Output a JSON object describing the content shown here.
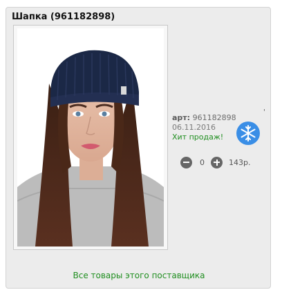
{
  "product": {
    "title": "Шапка (961182898)",
    "article_label": "арт:",
    "article_value": "961182898",
    "date": "06.11.2016",
    "badge_text": "Хит продаж!",
    "season_icon": "snowflake-icon",
    "tick_mark": "'"
  },
  "quantity": {
    "decrease_icon": "minus-icon",
    "value": "0",
    "increase_icon": "plus-icon"
  },
  "price": "143р.",
  "footer": {
    "supplier_link": "Все товары этого поставщика"
  },
  "colors": {
    "link_green": "#1f8e1f",
    "badge_blue": "#3a8ee6",
    "hat_navy": "#1b2846",
    "card_bg": "#ececec"
  }
}
